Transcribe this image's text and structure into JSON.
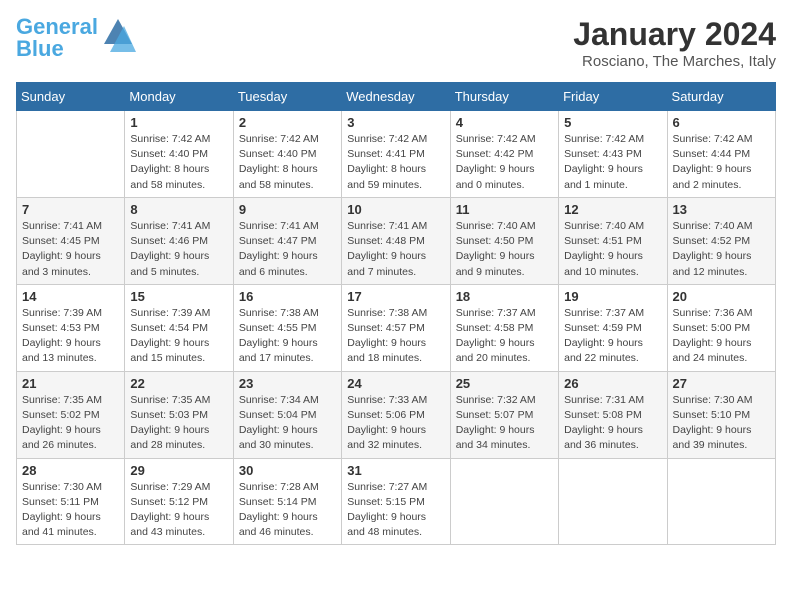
{
  "header": {
    "logo_line1": "General",
    "logo_line2": "Blue",
    "month": "January 2024",
    "location": "Rosciano, The Marches, Italy"
  },
  "weekdays": [
    "Sunday",
    "Monday",
    "Tuesday",
    "Wednesday",
    "Thursday",
    "Friday",
    "Saturday"
  ],
  "weeks": [
    [
      {
        "day": "",
        "info": ""
      },
      {
        "day": "1",
        "info": "Sunrise: 7:42 AM\nSunset: 4:40 PM\nDaylight: 8 hours\nand 58 minutes."
      },
      {
        "day": "2",
        "info": "Sunrise: 7:42 AM\nSunset: 4:40 PM\nDaylight: 8 hours\nand 58 minutes."
      },
      {
        "day": "3",
        "info": "Sunrise: 7:42 AM\nSunset: 4:41 PM\nDaylight: 8 hours\nand 59 minutes."
      },
      {
        "day": "4",
        "info": "Sunrise: 7:42 AM\nSunset: 4:42 PM\nDaylight: 9 hours\nand 0 minutes."
      },
      {
        "day": "5",
        "info": "Sunrise: 7:42 AM\nSunset: 4:43 PM\nDaylight: 9 hours\nand 1 minute."
      },
      {
        "day": "6",
        "info": "Sunrise: 7:42 AM\nSunset: 4:44 PM\nDaylight: 9 hours\nand 2 minutes."
      }
    ],
    [
      {
        "day": "7",
        "info": "Sunrise: 7:41 AM\nSunset: 4:45 PM\nDaylight: 9 hours\nand 3 minutes."
      },
      {
        "day": "8",
        "info": "Sunrise: 7:41 AM\nSunset: 4:46 PM\nDaylight: 9 hours\nand 5 minutes."
      },
      {
        "day": "9",
        "info": "Sunrise: 7:41 AM\nSunset: 4:47 PM\nDaylight: 9 hours\nand 6 minutes."
      },
      {
        "day": "10",
        "info": "Sunrise: 7:41 AM\nSunset: 4:48 PM\nDaylight: 9 hours\nand 7 minutes."
      },
      {
        "day": "11",
        "info": "Sunrise: 7:40 AM\nSunset: 4:50 PM\nDaylight: 9 hours\nand 9 minutes."
      },
      {
        "day": "12",
        "info": "Sunrise: 7:40 AM\nSunset: 4:51 PM\nDaylight: 9 hours\nand 10 minutes."
      },
      {
        "day": "13",
        "info": "Sunrise: 7:40 AM\nSunset: 4:52 PM\nDaylight: 9 hours\nand 12 minutes."
      }
    ],
    [
      {
        "day": "14",
        "info": "Sunrise: 7:39 AM\nSunset: 4:53 PM\nDaylight: 9 hours\nand 13 minutes."
      },
      {
        "day": "15",
        "info": "Sunrise: 7:39 AM\nSunset: 4:54 PM\nDaylight: 9 hours\nand 15 minutes."
      },
      {
        "day": "16",
        "info": "Sunrise: 7:38 AM\nSunset: 4:55 PM\nDaylight: 9 hours\nand 17 minutes."
      },
      {
        "day": "17",
        "info": "Sunrise: 7:38 AM\nSunset: 4:57 PM\nDaylight: 9 hours\nand 18 minutes."
      },
      {
        "day": "18",
        "info": "Sunrise: 7:37 AM\nSunset: 4:58 PM\nDaylight: 9 hours\nand 20 minutes."
      },
      {
        "day": "19",
        "info": "Sunrise: 7:37 AM\nSunset: 4:59 PM\nDaylight: 9 hours\nand 22 minutes."
      },
      {
        "day": "20",
        "info": "Sunrise: 7:36 AM\nSunset: 5:00 PM\nDaylight: 9 hours\nand 24 minutes."
      }
    ],
    [
      {
        "day": "21",
        "info": "Sunrise: 7:35 AM\nSunset: 5:02 PM\nDaylight: 9 hours\nand 26 minutes."
      },
      {
        "day": "22",
        "info": "Sunrise: 7:35 AM\nSunset: 5:03 PM\nDaylight: 9 hours\nand 28 minutes."
      },
      {
        "day": "23",
        "info": "Sunrise: 7:34 AM\nSunset: 5:04 PM\nDaylight: 9 hours\nand 30 minutes."
      },
      {
        "day": "24",
        "info": "Sunrise: 7:33 AM\nSunset: 5:06 PM\nDaylight: 9 hours\nand 32 minutes."
      },
      {
        "day": "25",
        "info": "Sunrise: 7:32 AM\nSunset: 5:07 PM\nDaylight: 9 hours\nand 34 minutes."
      },
      {
        "day": "26",
        "info": "Sunrise: 7:31 AM\nSunset: 5:08 PM\nDaylight: 9 hours\nand 36 minutes."
      },
      {
        "day": "27",
        "info": "Sunrise: 7:30 AM\nSunset: 5:10 PM\nDaylight: 9 hours\nand 39 minutes."
      }
    ],
    [
      {
        "day": "28",
        "info": "Sunrise: 7:30 AM\nSunset: 5:11 PM\nDaylight: 9 hours\nand 41 minutes."
      },
      {
        "day": "29",
        "info": "Sunrise: 7:29 AM\nSunset: 5:12 PM\nDaylight: 9 hours\nand 43 minutes."
      },
      {
        "day": "30",
        "info": "Sunrise: 7:28 AM\nSunset: 5:14 PM\nDaylight: 9 hours\nand 46 minutes."
      },
      {
        "day": "31",
        "info": "Sunrise: 7:27 AM\nSunset: 5:15 PM\nDaylight: 9 hours\nand 48 minutes."
      },
      {
        "day": "",
        "info": ""
      },
      {
        "day": "",
        "info": ""
      },
      {
        "day": "",
        "info": ""
      }
    ]
  ]
}
